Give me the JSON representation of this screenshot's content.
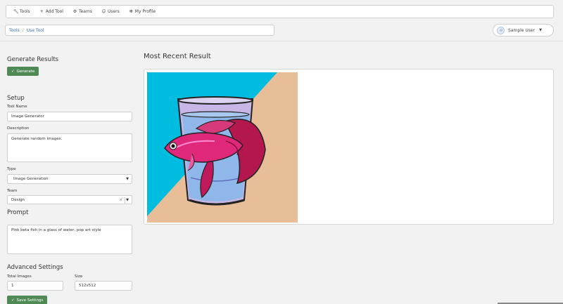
{
  "nav": {
    "items": [
      {
        "label": "Tools",
        "icon": "wrench-icon"
      },
      {
        "label": "Add Tool",
        "icon": "plus-icon"
      },
      {
        "label": "Teams",
        "icon": "gear-icon"
      },
      {
        "label": "Users",
        "icon": "users-icon"
      },
      {
        "label": "My Profile",
        "icon": "profile-icon"
      }
    ]
  },
  "breadcrumb": {
    "root": "Tools",
    "sep": "/",
    "current": "Use Tool"
  },
  "user": {
    "name": "Sample User"
  },
  "generate": {
    "heading": "Generate Results",
    "button": "Generate"
  },
  "setup": {
    "heading": "Setup",
    "tool_name_label": "Tool Name",
    "tool_name_value": "Image Generator",
    "description_label": "Description",
    "description_value": "Generate random images.",
    "type_label": "Type",
    "type_value": "Image Generation",
    "team_label": "Team",
    "team_value": "Design"
  },
  "prompt": {
    "heading": "Prompt",
    "value": "Pink beta fish in a glass of water, pop art style"
  },
  "advanced": {
    "heading": "Advanced Settings",
    "total_images_label": "Total Images",
    "total_images_value": "1",
    "size_label": "Size",
    "size_value": "512x512",
    "save_button": "Save Settings"
  },
  "result": {
    "heading": "Most Recent Result"
  },
  "colors": {
    "accent_green": "#4f8a55",
    "link_blue": "#3a6fb0",
    "image_cyan": "#00bde0",
    "image_peach": "#e7be98"
  }
}
